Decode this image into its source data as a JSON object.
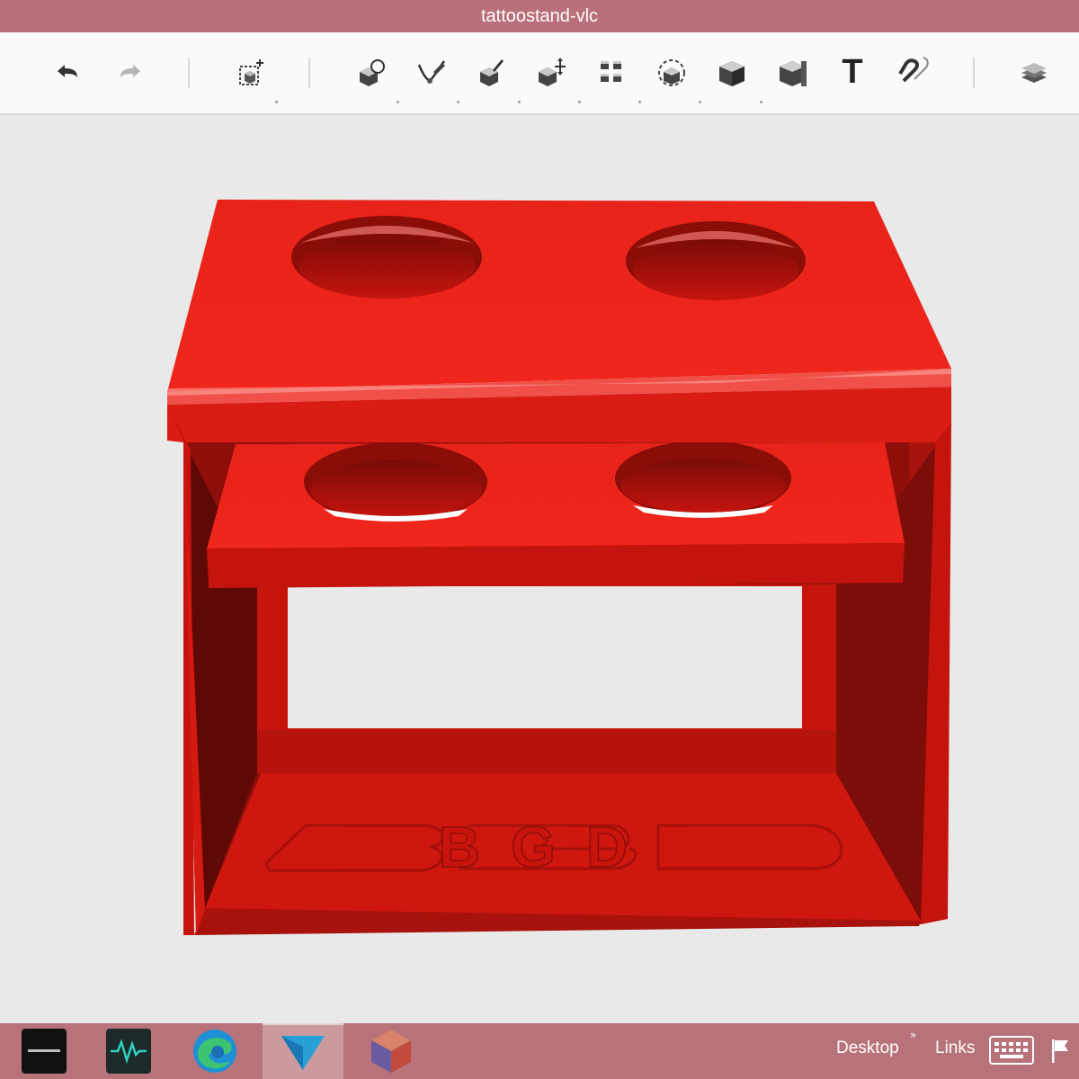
{
  "window": {
    "title": "tattoostand-vlc"
  },
  "toolbar": {
    "buttons": [
      {
        "name": "undo-button",
        "icon": "undo-icon"
      },
      {
        "name": "redo-button",
        "icon": "redo-icon"
      },
      {
        "name": "add-shape-button",
        "icon": "add-shape-icon"
      },
      {
        "name": "sketch-button",
        "icon": "sketch-icon"
      },
      {
        "name": "pen-button",
        "icon": "pen-icon"
      },
      {
        "name": "paint-button",
        "icon": "paint-icon"
      },
      {
        "name": "move-button",
        "icon": "move-icon"
      },
      {
        "name": "pattern-button",
        "icon": "pattern-icon"
      },
      {
        "name": "group-button",
        "icon": "group-icon"
      },
      {
        "name": "solid-button",
        "icon": "solid-icon"
      },
      {
        "name": "material-button",
        "icon": "material-icon"
      },
      {
        "name": "text-button",
        "icon": "text-icon",
        "label": "T"
      },
      {
        "name": "snap-button",
        "icon": "magnet-icon"
      },
      {
        "name": "layers-button",
        "icon": "layers-icon"
      }
    ]
  },
  "model": {
    "name": "tattoo stand",
    "color": "#e21a12",
    "engraving": "BGD"
  },
  "taskbar": {
    "apps": [
      {
        "name": "app-dark-terminal",
        "icon": "terminal-icon"
      },
      {
        "name": "app-audio",
        "icon": "audio-app-icon"
      },
      {
        "name": "app-edge",
        "icon": "edge-icon"
      },
      {
        "name": "app-3d-viewer",
        "icon": "viewer-icon"
      },
      {
        "name": "app-meshmixer",
        "icon": "polyhedron-icon"
      }
    ],
    "desktop_label": "Desktop",
    "chevron": "»",
    "links_label": "Links"
  },
  "colors": {
    "titlebar": "#b9707a",
    "taskbar": "#b77379",
    "model_red": "#e21a12",
    "background": "#e9e9e9"
  }
}
